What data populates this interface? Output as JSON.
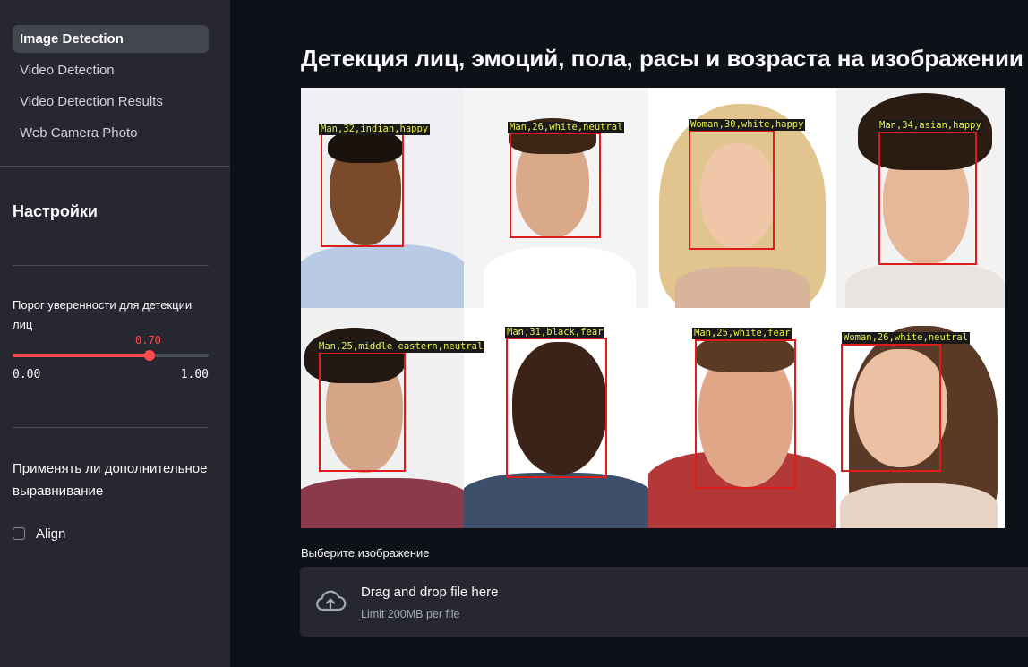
{
  "sidebar": {
    "nav": [
      {
        "label": "Image Detection",
        "active": true
      },
      {
        "label": "Video Detection",
        "active": false
      },
      {
        "label": "Video Detection Results",
        "active": false
      },
      {
        "label": "Web Camera Photo",
        "active": false
      }
    ],
    "settings_title": "Настройки",
    "slider": {
      "label": "Порог уверенности для детекции лиц",
      "value_text": "0.70",
      "value": 0.7,
      "min_text": "0.00",
      "max_text": "1.00"
    },
    "align_question": "Применять ли дополнительное выравнивание",
    "align_checkbox": {
      "label": "Align",
      "checked": false
    }
  },
  "main": {
    "title": "Детекция лиц, эмоций, пола, расы и возраста на изображении",
    "detections": [
      {
        "label": "Man,32,indian,happy"
      },
      {
        "label": "Man,26,white,neutral"
      },
      {
        "label": "Woman,30,white,happy"
      },
      {
        "label": "Man,34,asian,happy"
      },
      {
        "label": "Man,25,middle eastern,neutral"
      },
      {
        "label": "Man,31,black,fear"
      },
      {
        "label": "Man,25,white,fear"
      },
      {
        "label": "Woman,26,white,neutral"
      }
    ],
    "uploader": {
      "label": "Выберите изображение",
      "drop_title": "Drag and drop file here",
      "drop_sub": "Limit 200MB per file",
      "icon": "cloud-upload-icon"
    }
  },
  "colors": {
    "background": "#0e1117",
    "sidebar": "#262730",
    "accent": "#ff4b4b",
    "bbox": "#e01b1b",
    "bbox_text": "#e8f04a"
  }
}
